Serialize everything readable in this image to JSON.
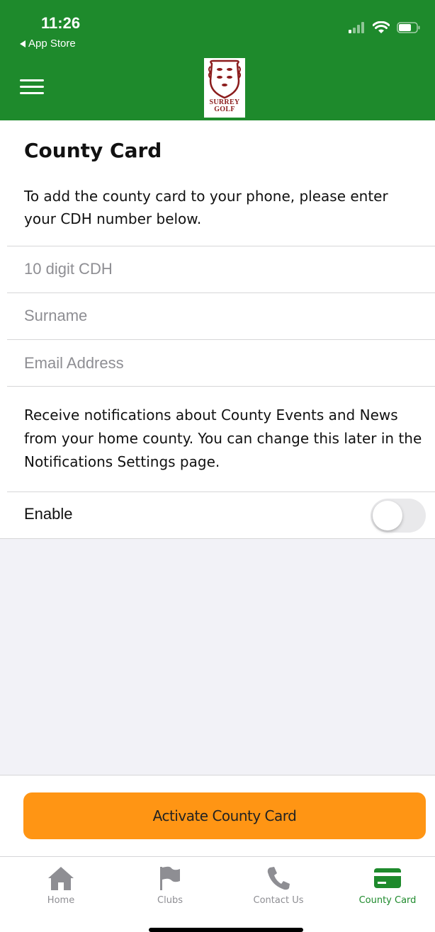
{
  "status_bar": {
    "time": "11:26",
    "back_label": "App Store"
  },
  "header": {
    "logo_text_line1": "SURREY",
    "logo_text_line2": "GOLF"
  },
  "page": {
    "title": "County Card",
    "intro": "To add the county card to your phone, please enter your CDH number below."
  },
  "form": {
    "cdh_placeholder": "10 digit CDH",
    "surname_placeholder": "Surname",
    "email_placeholder": "Email Address"
  },
  "notifications": {
    "text": "Receive notifications about County Events and News from your home county. You can change this later in the Notifications Settings page.",
    "enable_label": "Enable",
    "enabled": false
  },
  "activate_button": "Activate County Card",
  "tabs": [
    {
      "label": "Home",
      "icon": "home-icon"
    },
    {
      "label": "Clubs",
      "icon": "flag-icon"
    },
    {
      "label": "Contact Us",
      "icon": "phone-icon"
    },
    {
      "label": "County Card",
      "icon": "card-icon",
      "active": true
    }
  ],
  "colors": {
    "header_green": "#1e8a2c",
    "button_orange": "#ff9514",
    "active_tab": "#1e8a2c",
    "inactive_tab": "#8e8e93"
  }
}
